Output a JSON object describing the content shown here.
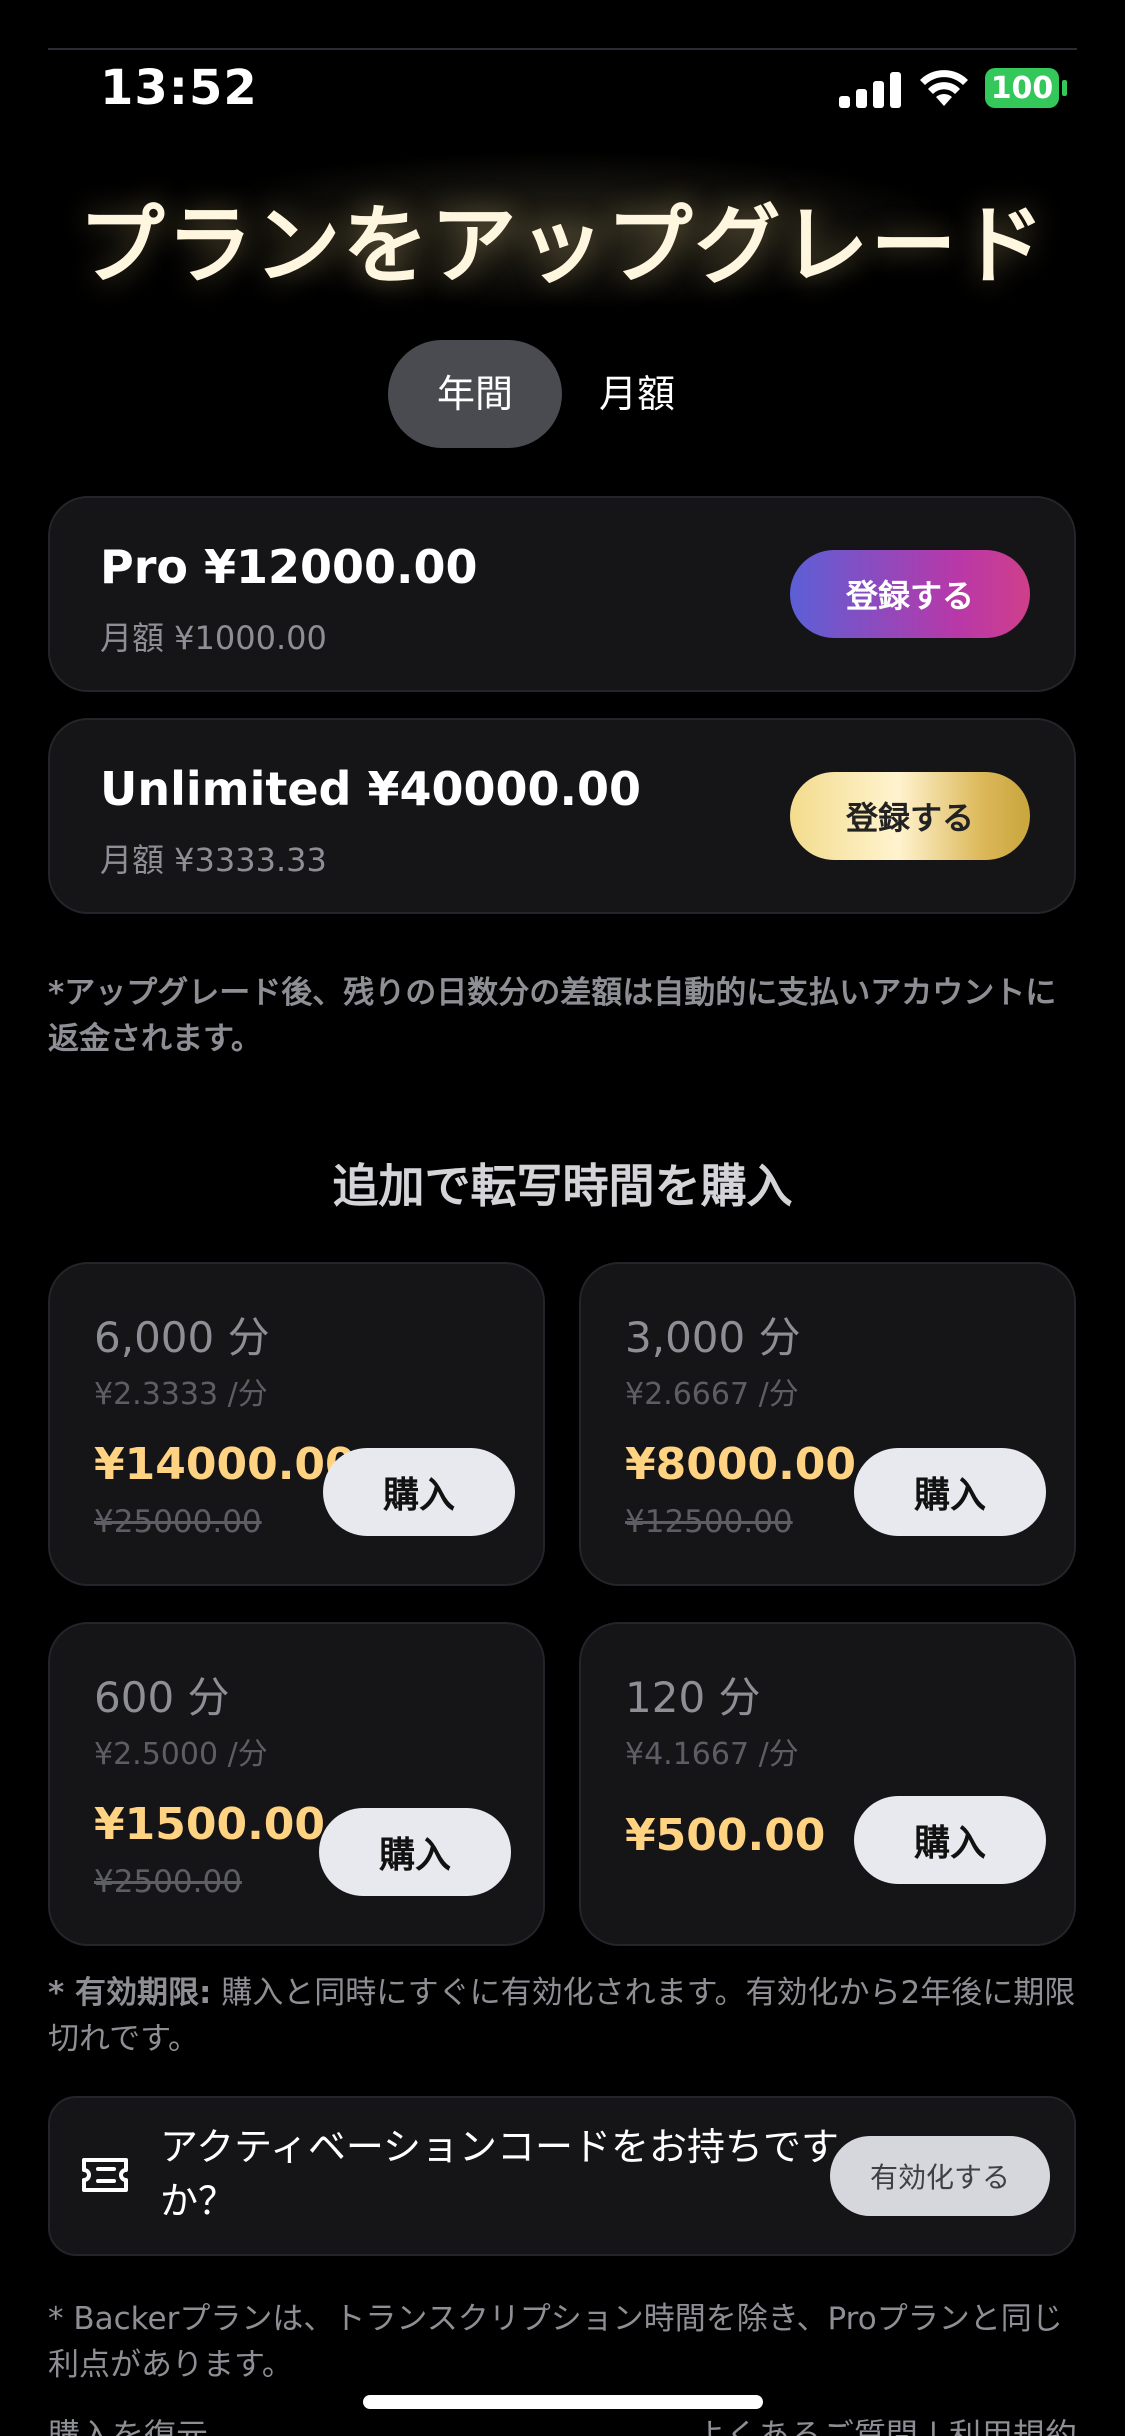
{
  "status_bar": {
    "time": "13:52",
    "battery": "100",
    "battery_color": "#34c759"
  },
  "header": {
    "title": "プランをアップグレード"
  },
  "billing_toggle": {
    "annual_label": "年間",
    "monthly_label": "月額",
    "selected": "annual"
  },
  "plans": [
    {
      "name": "Pro ¥12000.00",
      "monthly": "月額 ¥1000.00",
      "button_label": "登録する",
      "button_style": "purple-pink-gradient"
    },
    {
      "name": "Unlimited ¥40000.00",
      "monthly": "月額 ¥3333.33",
      "button_label": "登録する",
      "button_style": "gold-gradient"
    }
  ],
  "upgrade_note": "*アップグレード後、残りの日数分の差額は自動的に支払いアカウントに返金されます。",
  "addon": {
    "section_title": "追加で転写時間を購入",
    "packs": [
      {
        "amount": "6,000 分",
        "rate": "¥2.3333 /分",
        "price": "¥14000.00",
        "original_price": "¥25000.00",
        "button_label": "購入"
      },
      {
        "amount": "3,000 分",
        "rate": "¥2.6667 /分",
        "price": "¥8000.00",
        "original_price": "¥12500.00",
        "button_label": "購入"
      },
      {
        "amount": "600 分",
        "rate": "¥2.5000 /分",
        "price": "¥1500.00",
        "original_price": "¥2500.00",
        "button_label": "購入"
      },
      {
        "amount": "120 分",
        "rate": "¥4.1667 /分",
        "price": "¥500.00",
        "original_price": "",
        "button_label": "購入"
      }
    ],
    "validity_label": "* 有効期限:",
    "validity_text": " 購入と同時にすぐに有効化されます。有効化から2年後に期限切れです。"
  },
  "activation": {
    "icon": "ticket-icon",
    "text": "アクティベーションコードをお持ちですか？",
    "button_label": "有効化する"
  },
  "footer_note": "* Backerプランは、トランスクリプション時間を除き、Proプランと同じ利点があります。",
  "bottom_links": {
    "restore": "購入を復元",
    "faq_terms": "よくあるご質問 | 利用規約"
  },
  "colors": {
    "background": "#000000",
    "card": "#151518",
    "price_gold": "#ffd382",
    "muted_text": "#8e8e95"
  }
}
